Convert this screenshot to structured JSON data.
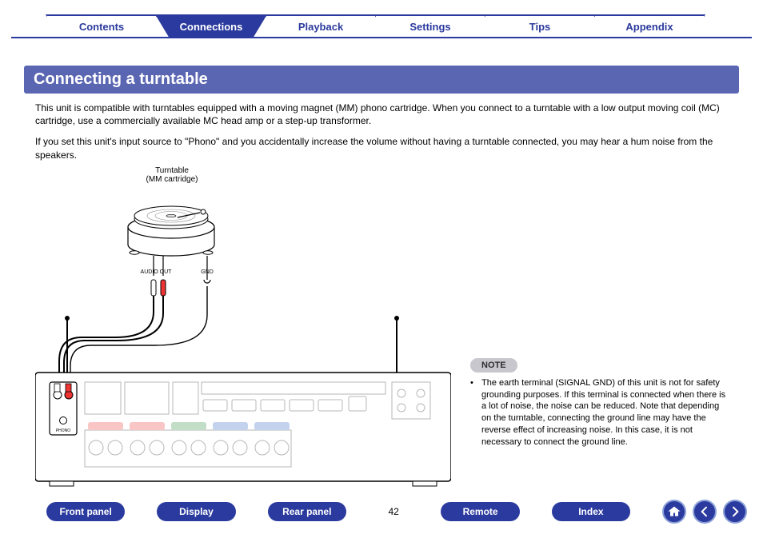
{
  "tabs": {
    "items": [
      {
        "label": "Contents",
        "active": false
      },
      {
        "label": "Connections",
        "active": true
      },
      {
        "label": "Playback",
        "active": false
      },
      {
        "label": "Settings",
        "active": false
      },
      {
        "label": "Tips",
        "active": false
      },
      {
        "label": "Appendix",
        "active": false
      }
    ]
  },
  "section": {
    "title": "Connecting a turntable",
    "para1": "This unit is compatible with turntables equipped with a moving magnet (MM) phono cartridge. When you connect to a turntable with a low output moving coil (MC) cartridge, use a commercially available MC head amp or a step-up transformer.",
    "para2": "If you set this unit's input source to \"Phono\" and you accidentally increase the volume without having a turntable connected, you may hear a hum noise from the speakers."
  },
  "diagram": {
    "turntable_label_line1": "Turntable",
    "turntable_label_line2": "(MM cartridge)",
    "audio_out_label": "AUDIO OUT",
    "gnd_label": "GND"
  },
  "note": {
    "heading": "NOTE",
    "text": "The earth terminal (SIGNAL GND) of this unit is not for safety grounding purposes. If this terminal is connected when there is a lot of noise, the noise can be reduced. Note that depending on the turntable, connecting the ground line may have the reverse effect of increasing noise. In this case, it is not necessary to connect the ground line."
  },
  "footer": {
    "buttons": [
      "Front panel",
      "Display",
      "Rear panel",
      "Remote",
      "Index"
    ],
    "page_number": "42"
  }
}
